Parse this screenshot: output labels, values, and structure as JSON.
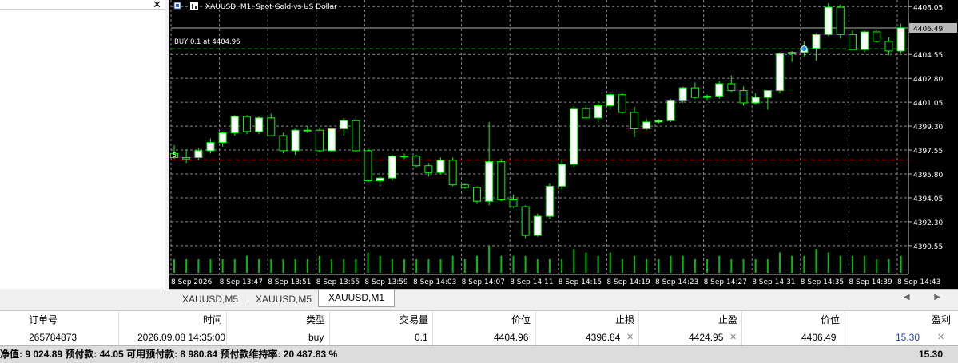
{
  "left_panel": {
    "close_glyph": "✕"
  },
  "chart": {
    "symbol_title": "XAUUSD, M1:  Spot Gold vs US Dollar",
    "position_label": "BUY 0.1 at 4404.96",
    "current_price": "4406.49",
    "order_marker": "5",
    "colors": {
      "background": "#000000",
      "grid": "#8a8a8a",
      "bull": "#ffffff",
      "bear": "#000000",
      "wick": "#00ff00",
      "volume": "#00c000",
      "buy_line": "#00a000",
      "sl_line": "#d00000",
      "bid_line": "#b0b0b0"
    },
    "y_ticks": [
      "4408.05",
      "4404.55",
      "4402.80",
      "4401.05",
      "4399.30",
      "4397.55",
      "4395.80",
      "4394.05",
      "4392.30",
      "4390.55"
    ],
    "x_ticks": [
      "8 Sep 2026",
      "8 Sep 13:47",
      "8 Sep 13:51",
      "8 Sep 13:55",
      "8 Sep 13:59",
      "8 Sep 14:03",
      "8 Sep 14:07",
      "8 Sep 14:11",
      "8 Sep 14:15",
      "8 Sep 14:19",
      "8 Sep 14:23",
      "8 Sep 14:27",
      "8 Sep 14:31",
      "8 Sep 14:35",
      "8 Sep 14:39",
      "8 Sep 14:43"
    ]
  },
  "chart_data": {
    "type": "candlestick",
    "title": "XAUUSD, M1:  Spot Gold vs US Dollar",
    "levels": {
      "buy": 4404.96,
      "stop_loss": 4396.84,
      "bid": 4406.49
    },
    "y_range": [
      4389.9,
      4408.3
    ],
    "candles": [
      [
        4397.3,
        4397.9,
        4396.9,
        4397.0
      ],
      [
        4397.0,
        4397.6,
        4396.6,
        4396.9
      ],
      [
        4397.0,
        4397.7,
        4396.8,
        4397.5
      ],
      [
        4397.5,
        4398.4,
        4397.3,
        4398.1
      ],
      [
        4398.1,
        4398.9,
        4397.8,
        4398.8
      ],
      [
        4398.8,
        4400.1,
        4398.6,
        4400.0
      ],
      [
        4400.0,
        4400.1,
        4398.7,
        4398.9
      ],
      [
        4398.9,
        4400.0,
        4398.7,
        4399.9
      ],
      [
        4399.9,
        4400.2,
        4398.6,
        4398.6
      ],
      [
        4398.6,
        4398.8,
        4397.3,
        4397.5
      ],
      [
        4397.5,
        4399.1,
        4397.2,
        4399.0
      ],
      [
        4399.0,
        4399.3,
        4398.8,
        4399.0
      ],
      [
        4399.0,
        4399.2,
        4397.4,
        4397.5
      ],
      [
        4397.5,
        4399.2,
        4397.4,
        4399.1
      ],
      [
        4399.1,
        4399.9,
        4398.6,
        4399.7
      ],
      [
        4399.7,
        4399.9,
        4397.4,
        4397.5
      ],
      [
        4397.5,
        4397.7,
        4395.2,
        4395.3
      ],
      [
        4395.3,
        4395.6,
        4394.9,
        4395.5
      ],
      [
        4395.5,
        4397.2,
        4395.3,
        4397.1
      ],
      [
        4397.1,
        4397.3,
        4396.9,
        4397.1
      ],
      [
        4397.1,
        4397.2,
        4396.3,
        4396.4
      ],
      [
        4396.4,
        4396.6,
        4395.6,
        4395.9
      ],
      [
        4395.9,
        4397.0,
        4395.8,
        4396.8
      ],
      [
        4396.8,
        4397.0,
        4394.9,
        4395.0
      ],
      [
        4395.0,
        4395.1,
        4394.7,
        4394.8
      ],
      [
        4394.8,
        4394.9,
        4393.6,
        4393.8
      ],
      [
        4393.8,
        4399.6,
        4393.5,
        4396.7
      ],
      [
        4396.7,
        4396.9,
        4393.8,
        4393.9
      ],
      [
        4393.9,
        4394.3,
        4393.3,
        4393.4
      ],
      [
        4393.4,
        4393.5,
        4391.1,
        4391.3
      ],
      [
        4391.3,
        4392.9,
        4391.2,
        4392.7
      ],
      [
        4392.7,
        4395.1,
        4392.5,
        4394.9
      ],
      [
        4394.9,
        4396.9,
        4394.7,
        4396.5
      ],
      [
        4396.5,
        4400.8,
        4396.3,
        4400.6
      ],
      [
        4400.6,
        4400.9,
        4399.7,
        4399.9
      ],
      [
        4399.9,
        4401.1,
        4399.5,
        4400.8
      ],
      [
        4400.8,
        4401.8,
        4400.5,
        4401.6
      ],
      [
        4401.6,
        4401.7,
        4400.2,
        4400.3
      ],
      [
        4400.3,
        4400.7,
        4398.5,
        4399.1
      ],
      [
        4399.1,
        4399.8,
        4399.0,
        4399.6
      ],
      [
        4399.6,
        4399.8,
        4399.5,
        4399.7
      ],
      [
        4399.7,
        4401.3,
        4399.6,
        4401.2
      ],
      [
        4401.2,
        4402.2,
        4401.0,
        4402.1
      ],
      [
        4402.1,
        4402.5,
        4401.3,
        4401.4
      ],
      [
        4401.4,
        4401.6,
        4401.2,
        4401.5
      ],
      [
        4401.5,
        4402.6,
        4401.3,
        4402.4
      ],
      [
        4402.4,
        4403.0,
        4401.8,
        4401.9
      ],
      [
        4401.9,
        4402.2,
        4400.8,
        4401.0
      ],
      [
        4401.0,
        4401.7,
        4400.9,
        4401.4
      ],
      [
        4401.4,
        4401.9,
        4400.5,
        4401.9
      ],
      [
        4401.9,
        4404.7,
        4401.7,
        4404.6
      ],
      [
        4404.6,
        4404.8,
        4404.0,
        4404.7
      ],
      [
        4404.7,
        4405.5,
        4404.4,
        4405.0
      ],
      [
        4405.0,
        4406.1,
        4404.1,
        4406.0
      ],
      [
        4406.0,
        4408.3,
        4405.9,
        4408.0
      ],
      [
        4408.0,
        4408.2,
        4405.7,
        4406.0
      ],
      [
        4406.0,
        4406.3,
        4404.9,
        4404.9
      ],
      [
        4404.9,
        4406.3,
        4404.7,
        4406.2
      ],
      [
        4406.2,
        4406.4,
        4405.4,
        4405.5
      ],
      [
        4405.5,
        4405.8,
        4404.5,
        4404.8
      ],
      [
        4404.8,
        4406.8,
        4404.6,
        4406.5
      ]
    ],
    "volume": [
      4,
      4,
      4,
      4,
      4,
      4,
      5,
      4,
      4,
      4,
      4,
      4,
      5,
      4,
      4,
      4,
      6,
      5,
      4,
      4,
      4,
      4,
      4,
      5,
      4,
      5,
      8,
      5,
      5,
      5,
      4,
      4,
      4,
      7,
      6,
      5,
      6,
      4,
      5,
      4,
      4,
      5,
      5,
      4,
      4,
      5,
      4,
      4,
      4,
      4,
      6,
      5,
      5,
      7,
      6,
      5,
      5,
      5,
      4,
      4,
      5
    ]
  },
  "tabs": [
    {
      "label": "XAUUSD,M5",
      "active": false
    },
    {
      "label": "XAUUSD,M5",
      "active": false
    },
    {
      "label": "XAUUSD,M1",
      "active": true
    }
  ],
  "tab_nav": "◀ ▶",
  "trade_table": {
    "headers": [
      "订单号",
      "时间",
      "类型",
      "交易量",
      "价位",
      "止损",
      "止盈",
      "价位",
      "盈利"
    ],
    "row": {
      "order": "265784873",
      "time": "2026.09.08 14:35:00",
      "type": "buy",
      "volume": "0.1",
      "open_price": "4404.96",
      "sl": "4396.84",
      "tp": "4424.95",
      "price": "4406.49",
      "profit": "15.30",
      "x_glyph": "✕"
    }
  },
  "status_bar": {
    "summary": "净值: 9 024.89  预付款: 44.05  可用预付款: 8 980.84  预付款维持率: 20 487.83 %",
    "profit": "15.30"
  }
}
